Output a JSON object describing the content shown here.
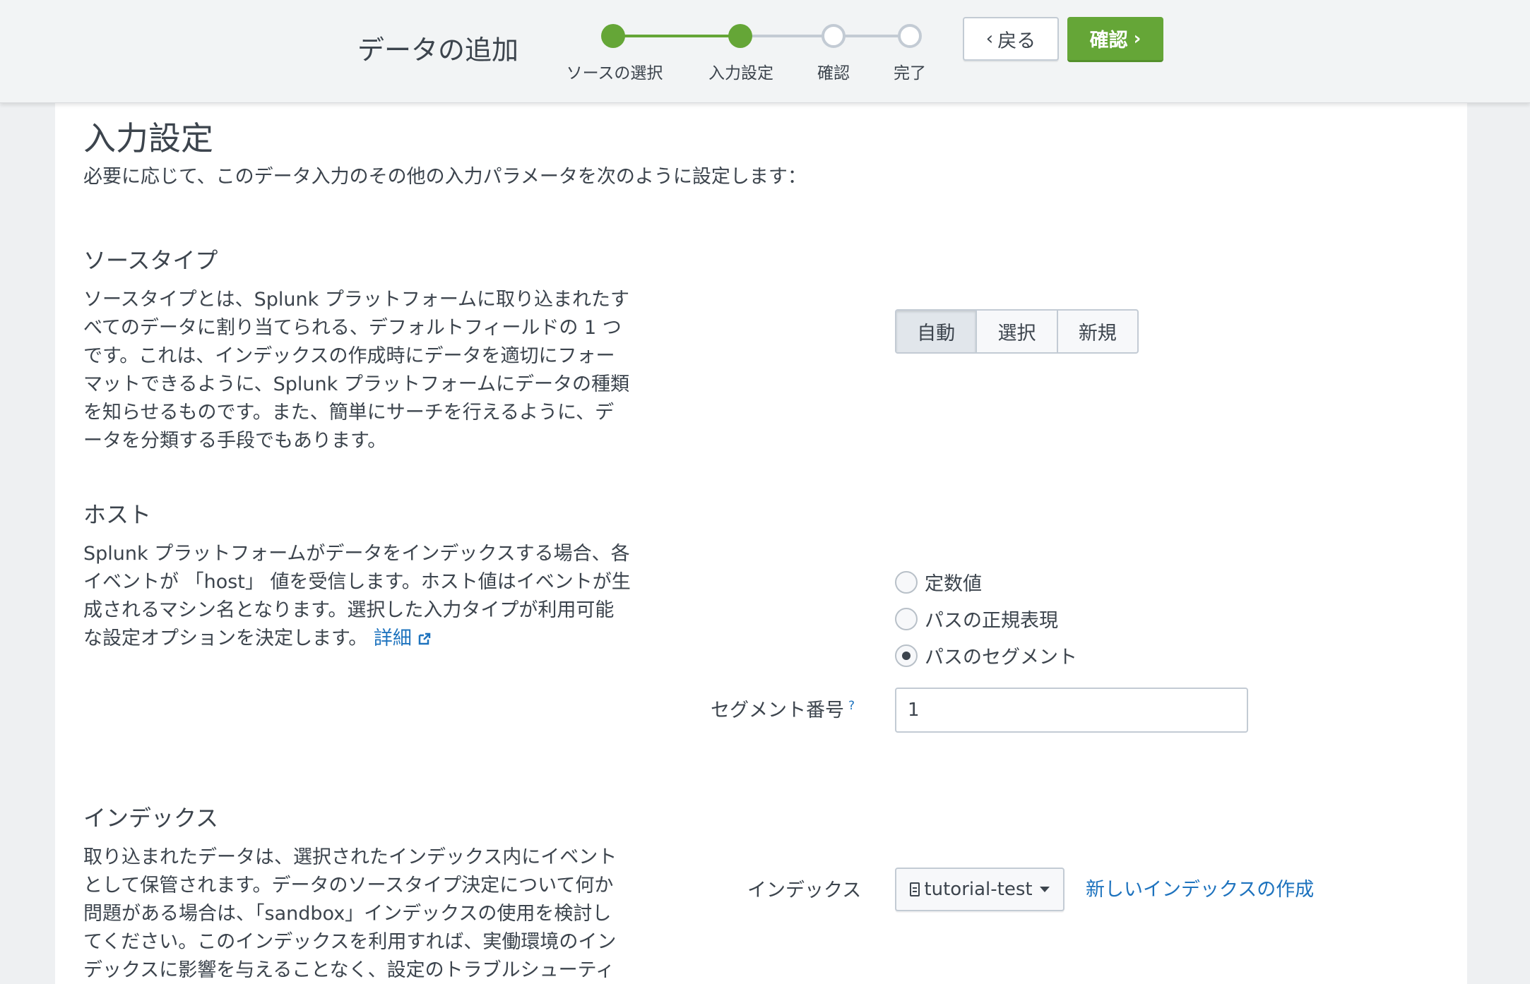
{
  "header": {
    "title": "データの追加",
    "steps": [
      {
        "label": "ソースの選択",
        "state": "done"
      },
      {
        "label": "入力設定",
        "state": "current"
      },
      {
        "label": "確認",
        "state": "todo"
      },
      {
        "label": "完了",
        "state": "todo"
      }
    ],
    "back_label": "戻る",
    "next_label": "確認",
    "accent_color": "#65a637"
  },
  "main": {
    "title": "入力設定",
    "subtitle": "必要に応じて、このデータ入力のその他の入力パラメータを次のように設定します：",
    "sourcetype": {
      "heading": "ソースタイプ",
      "lines": [
        "ソースタイプとは、Splunk プラットフォームに取り込まれたす",
        "べてのデータに割り当てられる、デフォルトフィールドの 1 つ",
        "です。これは、インデックスの作成時にデータを適切にフォー",
        "マットできるように、Splunk プラットフォームにデータの種類",
        "を知らせるものです。また、簡単にサーチを行えるように、デ",
        "ータを分類する手段でもあります。"
      ],
      "options": [
        "自動",
        "選択",
        "新規"
      ],
      "selected": "自動"
    },
    "host": {
      "heading": "ホスト",
      "lines": [
        "Splunk プラットフォームがデータをインデックスする場合、各",
        "イベントが 「host」 値を受信します。ホスト値はイベントが生",
        "成されるマシン名となります。選択した入力タイプが利用可能",
        "な設定オプションを決定します。"
      ],
      "link": "詳細",
      "radios": [
        {
          "label": "定数値",
          "checked": false
        },
        {
          "label": "パスの正規表現",
          "checked": false
        },
        {
          "label": "パスのセグメント",
          "checked": true
        }
      ],
      "segment_label": "セグメント番号",
      "segment_help": "?",
      "segment_value": "1"
    },
    "index": {
      "heading": "インデックス",
      "lines": [
        "取り込まれたデータは、選択されたインデックス内にイベント",
        "として保管されます。データのソースタイプ決定について何か",
        "問題がある場合は、「sandbox」インデックスの使用を検討し",
        "てください。このインデックスを利用すれば、実働環境のイン",
        "デックスに影響を与えることなく、設定のトラブルシューティ"
      ],
      "field_label": "インデックス",
      "selected": "tutorial-test",
      "create_link": "新しいインデックスの作成"
    }
  }
}
